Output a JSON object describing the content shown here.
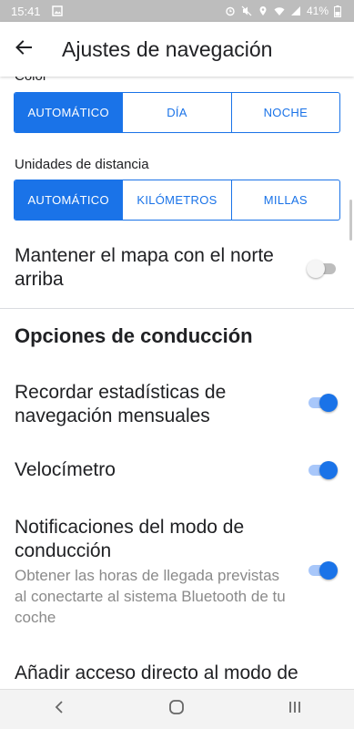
{
  "status_bar": {
    "time": "15:41",
    "battery": "41%"
  },
  "app_bar": {
    "title": "Ajustes de navegación"
  },
  "color_section": {
    "label": "Color",
    "options": [
      "AUTOMÁTICO",
      "DÍA",
      "NOCHE"
    ],
    "selected": "AUTOMÁTICO"
  },
  "distance_section": {
    "label": "Unidades de distancia",
    "options": [
      "AUTOMÁTICO",
      "KILÓMETROS",
      "MILLAS"
    ],
    "selected": "AUTOMÁTICO"
  },
  "north_up": {
    "title": "Mantener el mapa con el norte arriba",
    "enabled": false
  },
  "driving_options": {
    "header": "Opciones de conducción",
    "items": [
      {
        "title": "Recordar estadísticas de navegación mensuales",
        "enabled": true
      },
      {
        "title": "Velocímetro",
        "enabled": true
      },
      {
        "title": "Notificaciones del modo de conducción",
        "subtitle": "Obtener las horas de llegada previstas al conectarte al sistema Bluetooth de tu coche",
        "enabled": true
      },
      {
        "title": "Añadir acceso directo al modo de"
      }
    ]
  },
  "colors": {
    "accent": "#1a73e8",
    "toggle_track_on": "#a8c7fa",
    "status_bar_bg": "#bdbdbd"
  },
  "icons": {
    "back": "arrow-left-icon",
    "nav_back": "chevron-left-icon",
    "nav_home": "home-circle-icon",
    "nav_recents": "recents-icon"
  }
}
